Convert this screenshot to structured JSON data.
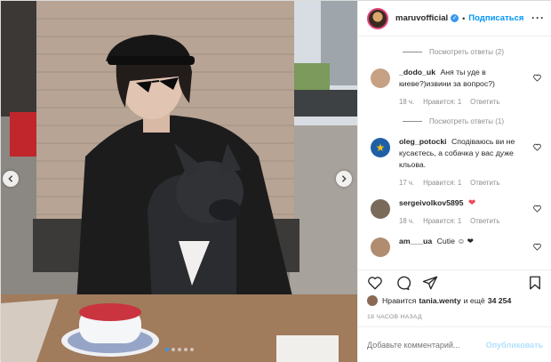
{
  "post": {
    "username": "maruvofficial",
    "follow_label": "Подписаться",
    "bullet": "•"
  },
  "comments": [
    {
      "type": "replies",
      "label": "Посмотреть ответы (2)"
    },
    {
      "type": "comment",
      "user": "_dodo_uk",
      "text": "Аня ты уде в киеве?)извини за вопрос?)",
      "time": "18 ч.",
      "likes": "Нравится: 1",
      "reply": "Ответить",
      "avatar_color": "#c7a184"
    },
    {
      "type": "replies",
      "label": "Посмотреть ответы (1)"
    },
    {
      "type": "comment",
      "user": "oleg_potocki",
      "text": "Сподіваюсь ви не кусаєтесь, а собачка у вас дуже кльова.",
      "time": "17 ч.",
      "likes": "Нравится: 1",
      "reply": "Ответить",
      "avatar_color": "#1f5fa6"
    },
    {
      "type": "comment",
      "user": "sergeivolkov5895",
      "text": "",
      "time": "18 ч.",
      "likes": "Нравится: 1",
      "reply": "Ответить",
      "avatar_color": "#7a6a5a"
    },
    {
      "type": "comment",
      "user": "am___ua",
      "text": "Cutie",
      "time": "",
      "likes": "",
      "reply": "",
      "avatar_color": "#b08c70"
    }
  ],
  "likes": {
    "prefix": "Нравится",
    "user": "tania.wenty",
    "mid": "и ещё",
    "count": "34 254"
  },
  "timestamp": "18 ЧАСОВ НАЗАД",
  "add_comment": {
    "placeholder": "Добавьте комментарий...",
    "publish": "Опубликовать"
  },
  "icons": {
    "like": "heart-outline-icon",
    "comment": "comment-icon",
    "share": "send-icon",
    "save": "bookmark-icon"
  },
  "colors": {
    "link": "#0095f6",
    "verified": "#3897f0",
    "muted": "#8e8e8e",
    "publish_disabled": "#b2dffc"
  },
  "carousel": {
    "total": 5,
    "active": 0
  }
}
